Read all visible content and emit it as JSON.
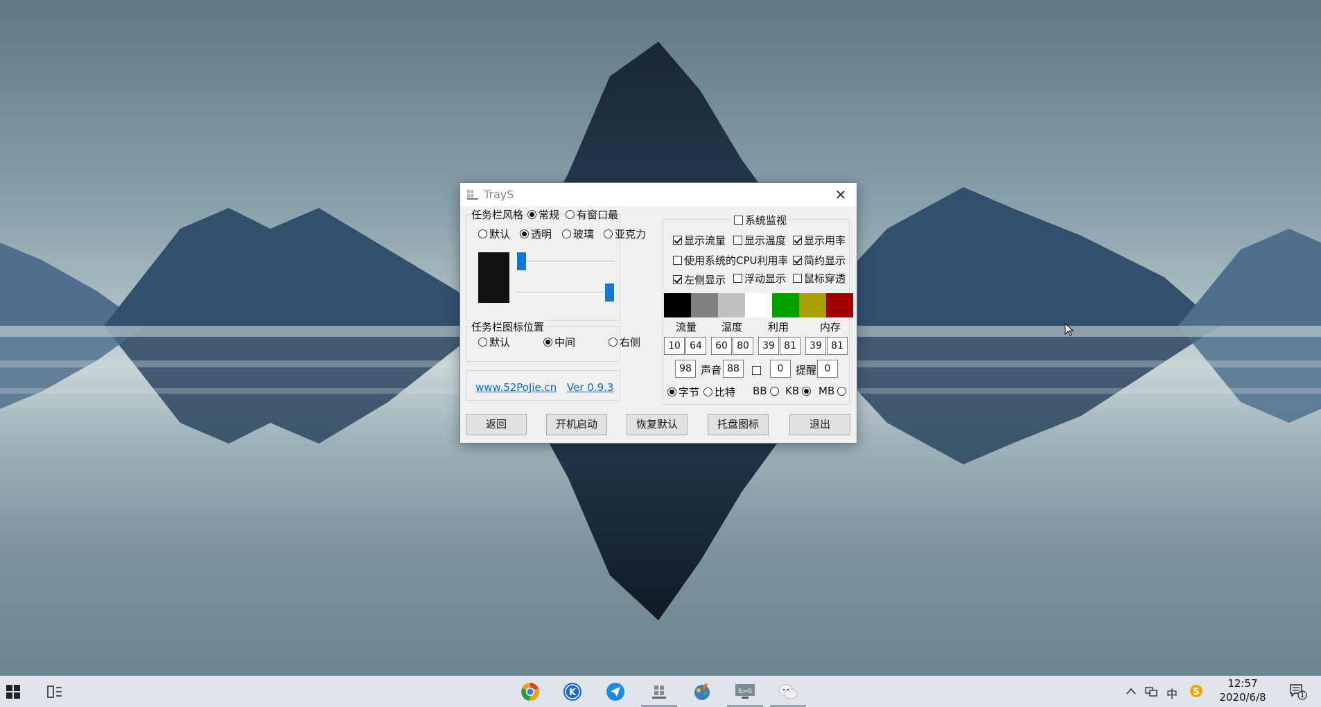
{
  "window": {
    "title": "TrayS",
    "close_glyph": "✕"
  },
  "taskbar_style": {
    "label": "任务栏风格",
    "options": [
      "常规",
      "有窗口最大化时"
    ],
    "selected": "常规",
    "effects": [
      "默认",
      "透明",
      "玻璃",
      "亚克力"
    ],
    "selected_effect": "透明",
    "preview_color": "#111214",
    "slider_top_value": 0,
    "slider_bottom_value": 1
  },
  "icon_position": {
    "label": "任务栏图标位置",
    "options": [
      "默认",
      "中间",
      "右侧"
    ],
    "selected": "中间"
  },
  "links": {
    "site": "www.52PoJie.cn",
    "version": "Ver 0.9.3"
  },
  "monitor": {
    "label": "系统监视",
    "enabled": false,
    "options": [
      {
        "label": "显示流量",
        "checked": true
      },
      {
        "label": "显示温度",
        "checked": false
      },
      {
        "label": "显示用率",
        "checked": true
      },
      {
        "label": "使用系统的CPU利用率",
        "checked": false
      },
      {
        "label": "简约显示",
        "checked": true
      },
      {
        "label": "左侧显示",
        "checked": true
      },
      {
        "label": "浮动显示",
        "checked": false
      },
      {
        "label": "鼠标穿透",
        "checked": false
      }
    ],
    "swatches": [
      "#000000",
      "#808080",
      "#c0c0c0",
      "#ffffff",
      "#00a000",
      "#a8a000",
      "#a00000"
    ],
    "headers": [
      "流量",
      "温度",
      "利用",
      "内存"
    ],
    "thresholds": [
      "10",
      "64",
      "60",
      "80",
      "39",
      "81",
      "39",
      "81"
    ],
    "sound_low": "98",
    "sound_label": "声音",
    "sound_high": "88",
    "alert_checked": false,
    "alert_value": "0",
    "remind_label": "提醒",
    "remind_value": "0",
    "units": [
      "字节",
      "比特"
    ],
    "selected_unit": "字节",
    "scales": [
      "BB",
      "KB",
      "MB"
    ],
    "selected_scale": "MB"
  },
  "buttons": [
    "返回",
    "开机启动",
    "恢复默认",
    "托盘图标",
    "退出"
  ],
  "taskbar": {
    "apps": [
      "chrome-icon",
      "k-app-icon",
      "paper-plane-icon",
      "trays-icon",
      "paint-icon",
      "sg-icon",
      "wechat-icon"
    ],
    "ime": "中",
    "time": "12:57",
    "date": "2020/6/8",
    "notification_count": "1"
  },
  "colors": {
    "accent": "#1278d6",
    "link": "#1666c0"
  }
}
